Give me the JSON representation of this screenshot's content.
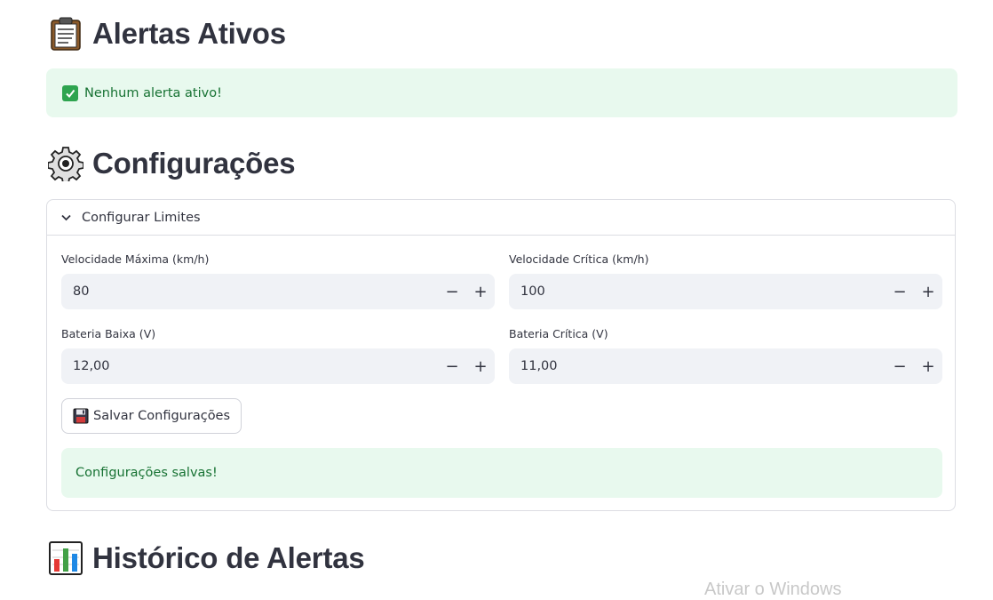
{
  "sections": {
    "alerts_title": "Alertas Ativos",
    "config_title": "Configurações",
    "history_title": "Histórico de Alertas"
  },
  "alerts": {
    "empty_message": "Nenhum alerta ativo!"
  },
  "config": {
    "expander_label": "Configurar Limites",
    "fields": [
      {
        "label": "Velocidade Máxima (km/h)",
        "value": "80"
      },
      {
        "label": "Velocidade Crítica (km/h)",
        "value": "100"
      },
      {
        "label": "Bateria Baixa (V)",
        "value": "12,00"
      },
      {
        "label": "Bateria Crítica (V)",
        "value": "11,00"
      }
    ],
    "save_button": "Salvar Configurações",
    "success_message": "Configurações salvas!"
  },
  "stepper": {
    "minus": "−",
    "plus": "+"
  },
  "watermark": "Ativar o Windows",
  "icons": {
    "alerts": "clipboard-icon",
    "config": "gear-icon",
    "history": "bar-chart-icon",
    "success": "check-icon",
    "save": "floppy-disk-icon",
    "expander": "chevron-down-icon"
  },
  "colors": {
    "success_bg": "#e8f9ee",
    "success_text": "#177233",
    "input_bg": "#f0f2f6"
  }
}
